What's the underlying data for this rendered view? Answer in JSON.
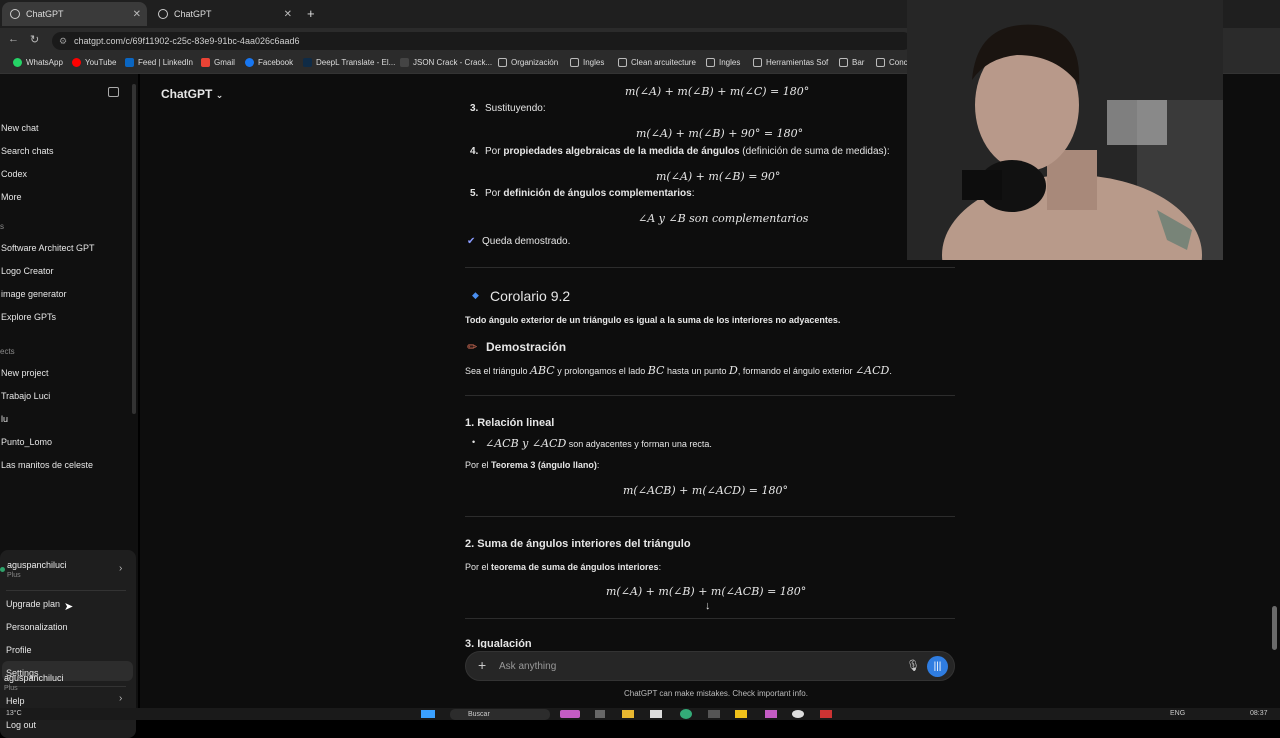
{
  "browser": {
    "tabs": [
      {
        "label": "ChatGPT"
      },
      {
        "label": "ChatGPT"
      }
    ],
    "url": "chatgpt.com/c/69f11902-c25c-83e9-91bc-4aa026c6aad6",
    "bookmarks": [
      "WhatsApp",
      "YouTube",
      "Feed | LinkedIn",
      "Gmail",
      "Facebook",
      "DeepL Translate - El...",
      "JSON Crack - Crack...",
      "Organización",
      "Ingles",
      "Clean arcuitecture",
      "Ingles",
      "Herramientas Sof",
      "Bar",
      "Conc"
    ]
  },
  "sidebar": {
    "top_items": [
      "New chat",
      "Search chats",
      "Codex",
      "More"
    ],
    "gpts_label": "s",
    "gpts": [
      "Software Architect GPT",
      "Logo Creator",
      "image generator",
      "Explore GPTs"
    ],
    "projects_label": "ects",
    "projects": [
      "New project",
      "Trabajo Luci",
      "lu",
      "Punto_Lomo",
      "Las manitos de celeste"
    ],
    "user_menu": {
      "username": "aguspanchiluci",
      "plan": "Plus",
      "items": [
        "Upgrade plan",
        "Personalization",
        "Profile",
        "Settings",
        "Help",
        "Log out"
      ]
    },
    "footer_user": "aguspanchiluci",
    "footer_plan": "Plus"
  },
  "main": {
    "model": "ChatGPT",
    "step3": "3.",
    "step3_label": "Sustituyendo:",
    "eq_top": "m(∠A) + m(∠B) + m(∠C) = 180°",
    "eq_sub": "m(∠A) + m(∠B) + 90° = 180°",
    "step4": "4.",
    "step4_pre": "Por ",
    "step4_bold": "propiedades algebraicas de la medida de ángulos",
    "step4_post": " (definición de suma de medidas):",
    "eq4": "m(∠A) + m(∠B) = 90°",
    "step5": "5.",
    "step5_pre": "Por ",
    "step5_bold": "definición de ángulos complementarios",
    "step5_post": ":",
    "eq5": "∠A y ∠B son complementarios",
    "qed": "Queda demostrado.",
    "corolario_title": "Corolario 9.2",
    "corolario_text": "Todo ángulo exterior de un triángulo es igual a la suma de los interiores no adyacentes.",
    "demo_title": "Demostración",
    "demo_text_1": "Sea el triángulo ",
    "demo_abc": "ABC",
    "demo_text_2": " y prolongamos el lado ",
    "demo_bc": "BC",
    "demo_text_3": " hasta un punto ",
    "demo_d": "D",
    "demo_text_4": ", formando el ángulo exterior ",
    "demo_acd": "∠ACD",
    "demo_text_5": ".",
    "rel_title": "1. Relación lineal",
    "rel_bullet_math": "∠ACB y ∠ACD",
    "rel_bullet_text": " son adyacentes y forman una recta.",
    "teorema_pre": "Por el ",
    "teorema_bold": "Teorema 3 (ángulo llano)",
    "teorema_post": ":",
    "eq_rel": "m(∠ACB) + m(∠ACD) = 180°",
    "suma_title": "2. Suma de ángulos interiores del triángulo",
    "suma_pre": "Por el ",
    "suma_bold": "teorema de suma de ángulos interiores",
    "suma_post": ":",
    "eq_suma": "m(∠A) + m(∠B) + m(∠ACB) = 180°",
    "igual_title": "3. Igualación",
    "composer_placeholder": "Ask anything",
    "disclaimer": "ChatGPT can make mistakes. Check important info."
  },
  "taskbar": {
    "weather": "13°C",
    "search": "Buscar",
    "lang": "ENG",
    "time": "08:37"
  },
  "colors": {
    "accent": "#2f7de1",
    "diamond": "#4a8ff0",
    "check": "#8a9cff"
  }
}
